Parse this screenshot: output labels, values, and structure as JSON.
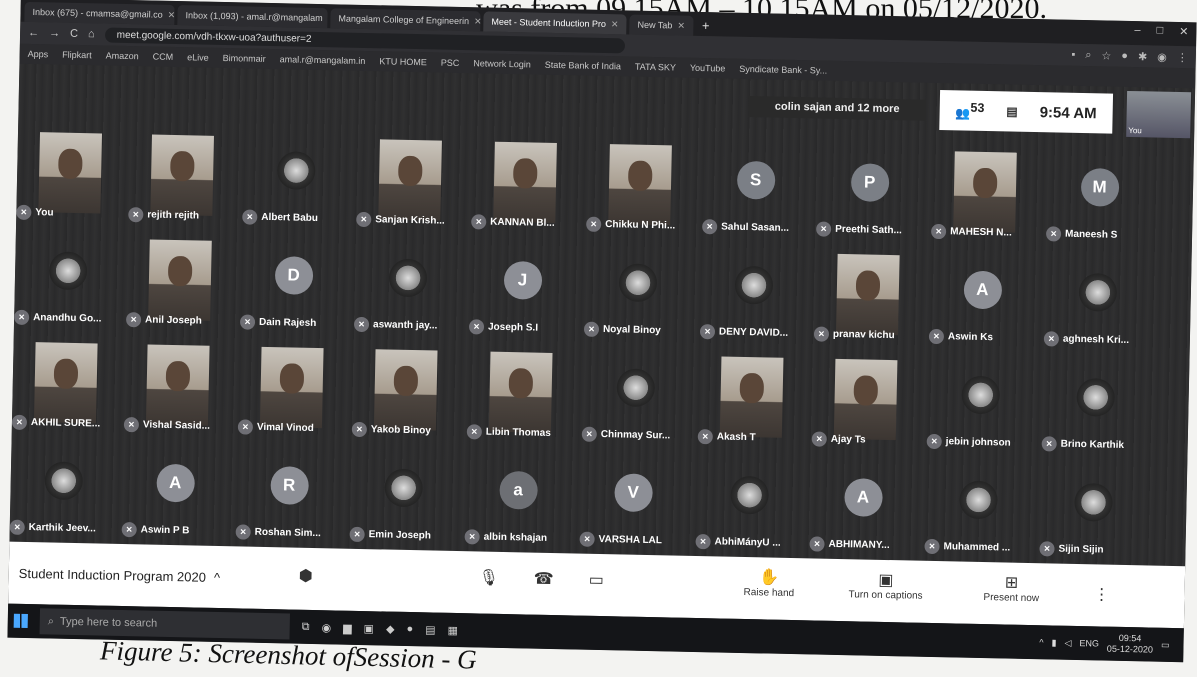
{
  "top_text": "was from 09.15AM – 10.15AM on 05/12/2020.",
  "caption": "Figure 5: Screenshot ofSession - G",
  "browser": {
    "tabs": [
      {
        "label": "Inbox (675) - cmamsa@gmail.co"
      },
      {
        "label": "Inbox (1,093) - amal.r@mangalam"
      },
      {
        "label": "Mangalam College of Engineerin"
      },
      {
        "label": "Meet - Student Induction Pro"
      },
      {
        "label": "New Tab"
      }
    ],
    "new_tab": "+",
    "window_controls": [
      "–",
      "□",
      "✕"
    ],
    "url": "meet.google.com/vdh-tkxw-uoa?authuser=2",
    "nav": [
      "←",
      "→",
      "C",
      "⌂"
    ],
    "bookmarks": [
      "Apps",
      "Flipkart",
      "Amazon",
      "CCM",
      "eLive",
      "Bimonmair",
      "amal.r@mangalam.in",
      "KTU HOME",
      "PSC",
      "Network Login",
      "State Bank of India",
      "TATA SKY",
      "YouTube",
      "Syndicate Bank - Sy..."
    ]
  },
  "meet": {
    "others": "colin sajan and 12 more",
    "participant_count": "53",
    "time": "9:54 AM",
    "self_label": "You",
    "participants": [
      {
        "name": "You",
        "type": "video"
      },
      {
        "name": "rejith rejith",
        "type": "video"
      },
      {
        "name": "Albert Babu",
        "type": "image"
      },
      {
        "name": "Sanjan Krish...",
        "type": "video"
      },
      {
        "name": "KANNAN Bl...",
        "type": "video"
      },
      {
        "name": "Chikku N Phi...",
        "type": "video"
      },
      {
        "name": "Sahul Sasan...",
        "type": "letter",
        "letter": "S",
        "color": "#7b7f86"
      },
      {
        "name": "Preethi Sath...",
        "type": "letter",
        "letter": "P",
        "color": "#7b7f86"
      },
      {
        "name": "MAHESH N...",
        "type": "video"
      },
      {
        "name": "Maneesh S",
        "type": "letter",
        "letter": "M",
        "color": "#7b7f86"
      },
      {
        "name": "Anandhu Go...",
        "type": "image"
      },
      {
        "name": "Anil Joseph",
        "type": "video"
      },
      {
        "name": "Dain Rajesh",
        "type": "letter",
        "letter": "D",
        "color": "#8d8f96"
      },
      {
        "name": "aswanth jay...",
        "type": "image"
      },
      {
        "name": "Joseph S.I",
        "type": "letter",
        "letter": "J",
        "color": "#8d8f96"
      },
      {
        "name": "Noyal Binoy",
        "type": "image"
      },
      {
        "name": "DENY DAVID...",
        "type": "image"
      },
      {
        "name": "pranav kichu",
        "type": "video"
      },
      {
        "name": "Aswin Ks",
        "type": "letter",
        "letter": "A",
        "color": "#8d8f96"
      },
      {
        "name": "aghnesh Kri...",
        "type": "image"
      },
      {
        "name": "AKHIL SURE...",
        "type": "video"
      },
      {
        "name": "Vishal Sasid...",
        "type": "video"
      },
      {
        "name": "Vimal Vinod",
        "type": "video"
      },
      {
        "name": "Yakob Binoy",
        "type": "video"
      },
      {
        "name": "Libin Thomas",
        "type": "video"
      },
      {
        "name": "Chinmay Sur...",
        "type": "image"
      },
      {
        "name": "Akash T",
        "type": "video"
      },
      {
        "name": "Ajay Ts",
        "type": "video"
      },
      {
        "name": "jebin johnson",
        "type": "image"
      },
      {
        "name": "Brino Karthik",
        "type": "image"
      },
      {
        "name": "Karthik Jeev...",
        "type": "image"
      },
      {
        "name": "Aswin P B",
        "type": "letter",
        "letter": "A",
        "color": "#8d8f96"
      },
      {
        "name": "Roshan Sim...",
        "type": "letter",
        "letter": "R",
        "color": "#8d8f96"
      },
      {
        "name": "Emin Joseph",
        "type": "image"
      },
      {
        "name": "albin kshajan",
        "type": "letter",
        "letter": "a",
        "color": "#6d6f74"
      },
      {
        "name": "VARSHA LAL",
        "type": "letter",
        "letter": "V",
        "color": "#8d8f96"
      },
      {
        "name": "AbhiMányU ...",
        "type": "image"
      },
      {
        "name": "ABHIMANY...",
        "type": "letter",
        "letter": "A",
        "color": "#8d8f96"
      },
      {
        "name": "Muhammed ...",
        "type": "image"
      },
      {
        "name": "Sijin Sijin",
        "type": "image"
      }
    ]
  },
  "controls": {
    "meeting_name": "Student Induction Program 2020",
    "raise_hand": "Raise hand",
    "captions": "Turn on captions",
    "present": "Present now",
    "more": "⋮"
  },
  "taskbar": {
    "search_placeholder": "Type here to search",
    "lang": "ENG",
    "clock_time": "09:54",
    "clock_date": "05-12-2020"
  }
}
